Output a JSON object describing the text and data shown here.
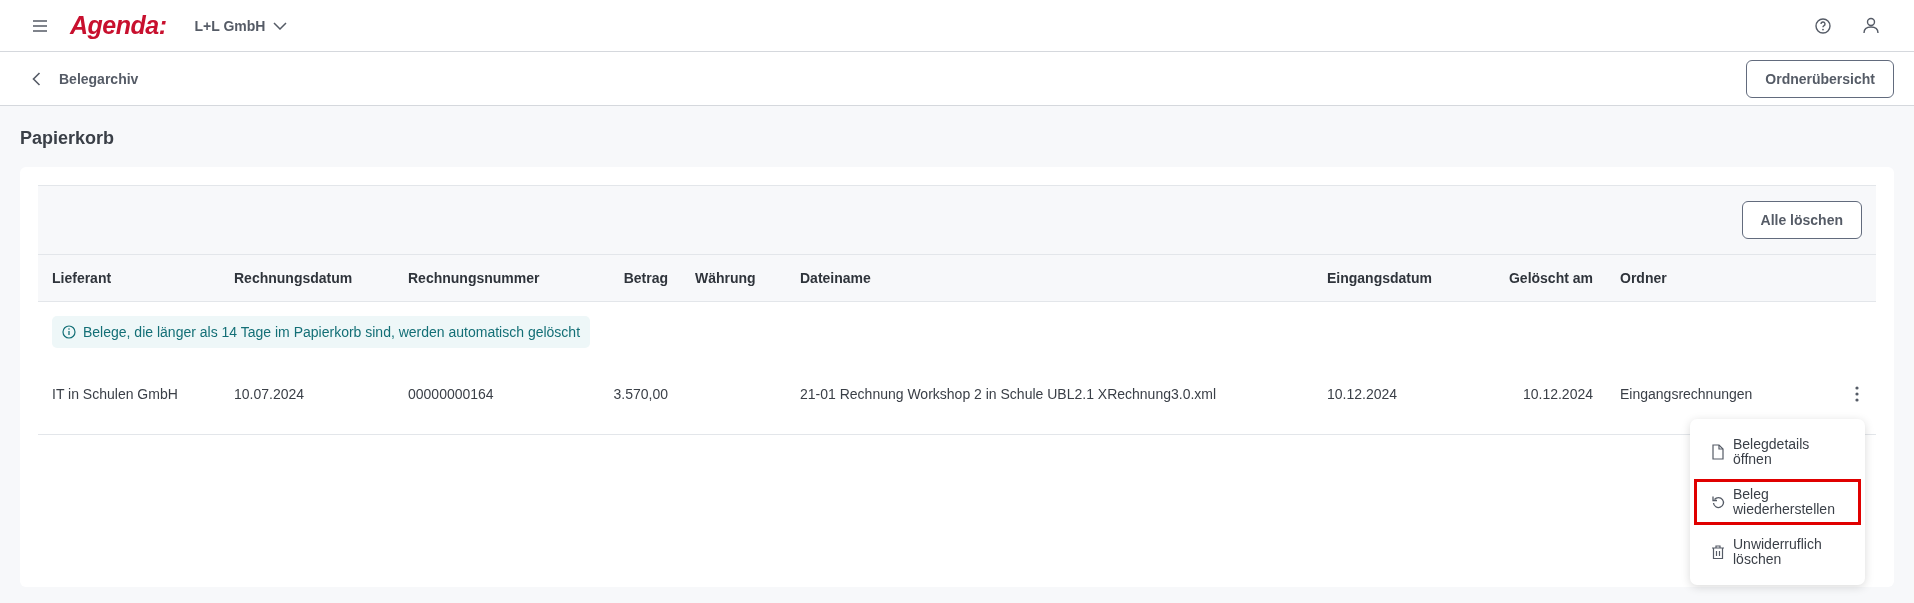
{
  "header": {
    "logo": "Agenda:",
    "company": "L+L GmbH"
  },
  "breadcrumb": {
    "back_label": "Belegarchiv",
    "button": "Ordnerübersicht"
  },
  "page_title": "Papierkorb",
  "toolbar": {
    "button": "Alle löschen"
  },
  "table": {
    "columns": [
      "Lieferant",
      "Rechnungsdatum",
      "Rechnungsnummer",
      "Betrag",
      "Währung",
      "Dateiname",
      "Eingangsdatum",
      "Gelöscht am",
      "Ordner"
    ],
    "info": "Belege, die länger als 14 Tage im Papierkorb sind, werden automatisch gelöscht",
    "rows": [
      {
        "cells": [
          "IT in Schulen GmbH",
          "10.07.2024",
          "00000000164",
          "3.570,00",
          "",
          "21-01 Rechnung Workshop 2 in Schule UBL2.1 XRechnung3.0.xml",
          "10.12.2024",
          "10.12.2024",
          "Eingangsrechnungen"
        ]
      }
    ]
  },
  "context_menu": {
    "items": [
      {
        "kind": "document",
        "label": "Belegdetails öffnen",
        "highlighted": false
      },
      {
        "kind": "restore",
        "label": "Beleg wiederherstellen",
        "highlighted": true
      },
      {
        "kind": "trash",
        "label": "Unwiderruflich löschen",
        "highlighted": false
      }
    ]
  }
}
